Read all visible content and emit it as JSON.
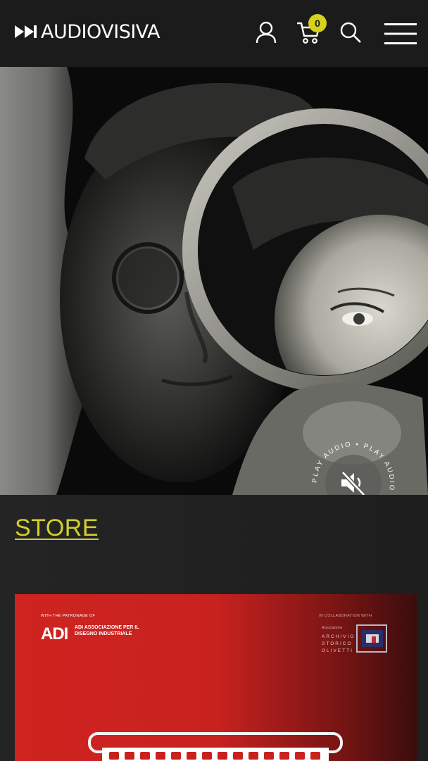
{
  "header": {
    "brand": "AUDIOVISIVA",
    "cart_count": "0"
  },
  "icons": {
    "logo": "fast-forward-icon",
    "user": "user-icon",
    "cart": "cart-icon",
    "search": "search-icon",
    "menu": "hamburger-menu-icon",
    "audio": "speaker-muted-icon"
  },
  "hero": {
    "audio_badge_text": "PLAY AUDIO • PLAY AUDIO • PLAY AUDIO • "
  },
  "store": {
    "heading": "STORE",
    "product": {
      "patronage_label": "WITH THE PATRONAGE OF",
      "adi_logo": "ADI",
      "adi_text": "ADI ASSOCIAZIONE PER IL DISEGNO INDUSTRIALE",
      "collab_label": "IN COLLABORATION WITH",
      "olivetti_small": "Associazione",
      "archivio_text": "ARCHIVIO STORICO OLIVETTI"
    }
  },
  "colors": {
    "accent": "#d4cf2a",
    "header_bg": "#1b1b1b",
    "card_red": "#cf2420"
  }
}
